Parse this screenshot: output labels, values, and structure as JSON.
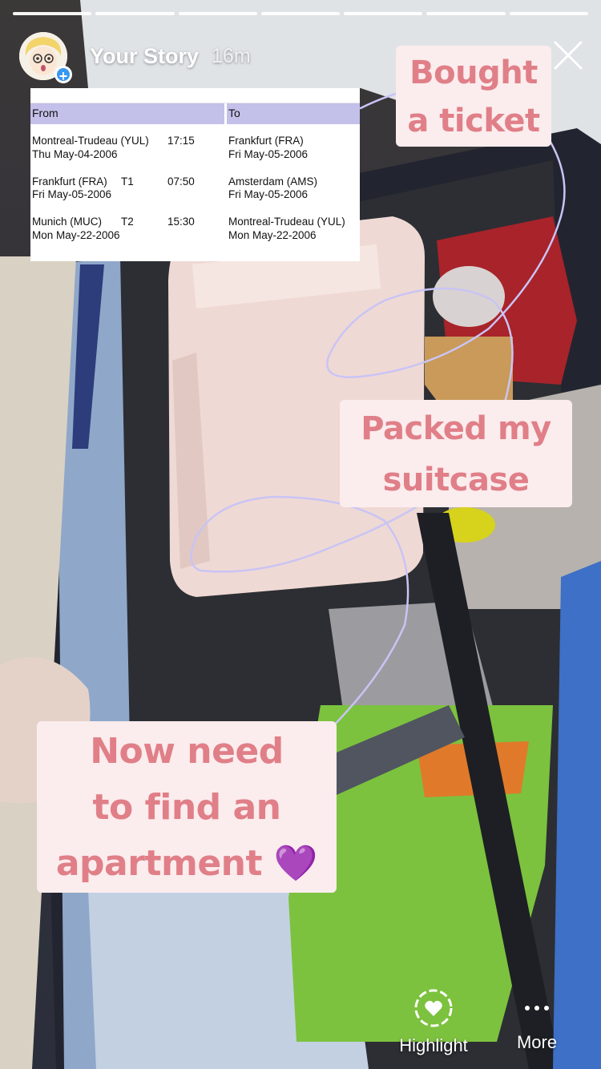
{
  "story": {
    "user": "Your Story",
    "time": "16m",
    "segments_total": 7,
    "segments_viewed": 7
  },
  "ticket": {
    "headers": {
      "from": "From",
      "to": "To"
    },
    "rows": [
      {
        "from_place": "Montreal-Trudeau (YUL)",
        "from_time": "17:15",
        "from_date": "Thu May-04-2006",
        "to_place": "Frankfurt (FRA)",
        "to_date": "Fri May-05-2006"
      },
      {
        "from_place": "Frankfurt (FRA)",
        "from_terminal": "T1",
        "from_time": "07:50",
        "from_date": "Fri May-05-2006",
        "to_place": "Amsterdam (AMS)",
        "to_date": "Fri May-05-2006"
      },
      {
        "from_place": "Munich (MUC)",
        "from_terminal": "T2",
        "from_time": "15:30",
        "from_date": "Mon May-22-2006",
        "to_place": "Montreal-Trudeau (YUL)",
        "to_date": "Mon May-22-2006"
      }
    ]
  },
  "stickers": {
    "bought": [
      "Bought",
      "a ticket"
    ],
    "packed": [
      "Packed my",
      "suitcase"
    ],
    "apartment": [
      "Now need",
      "to find an",
      "apartment 💜"
    ]
  },
  "actions": {
    "highlight": "Highlight",
    "more": "More"
  },
  "icons": {
    "close": "close-icon",
    "highlight": "heart-circle-icon",
    "more": "more-dots-icon",
    "avatar_badge": "plus-icon"
  },
  "colors": {
    "sticker_bg": "#fbeced",
    "sticker_text": "#e07f88",
    "doodle": "#c9c4f5",
    "badge": "#3897f0"
  }
}
